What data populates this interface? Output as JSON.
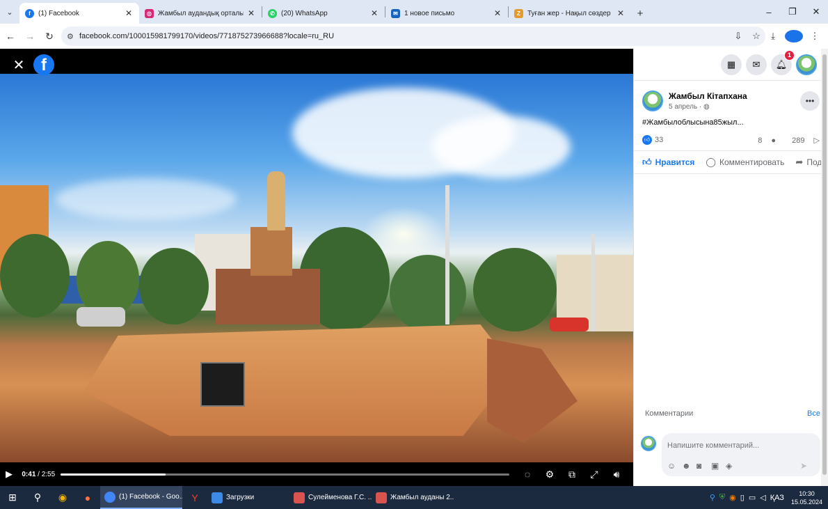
{
  "browser": {
    "tabs": [
      {
        "title": "(1) Facebook",
        "icon": "facebook-icon",
        "color": "#1877f2",
        "active": true
      },
      {
        "title": "Жамбыл аудандық орталық к",
        "icon": "instagram-icon",
        "color": "#d62976",
        "active": false
      },
      {
        "title": "(20) WhatsApp",
        "icon": "whatsapp-icon",
        "color": "#25d366",
        "active": false
      },
      {
        "title": "1 новое письмо",
        "icon": "mail-icon",
        "color": "#1565c0",
        "active": false
      },
      {
        "title": "Туған жер - Нақыл сөздер",
        "icon": "zq-icon",
        "color": "#e39b2b",
        "active": false
      }
    ],
    "url": "facebook.com/100015981799170/videos/771875273966688?locale=ru_RU"
  },
  "video": {
    "current_time": "0:41",
    "duration": "2:55",
    "progress": 0.234
  },
  "post": {
    "page_name": "Жамбыл Кітапхана",
    "date": "5 апрель ·",
    "text": "#Жамбылоблысына85жыл...",
    "likes": "33",
    "comments_count": "8",
    "views": "289",
    "actions": {
      "like": "Нравится",
      "comment": "Комментировать",
      "share": "Поделиться"
    }
  },
  "header": {
    "notifications_badge": "1"
  },
  "comments": {
    "title": "Комментарии",
    "all": "Все",
    "placeholder": "Напишите комментарий..."
  },
  "taskbar": {
    "apps": [
      {
        "label": "(1) Facebook - Goo...",
        "color": "#4285f4",
        "active": true
      },
      {
        "label": "Загрузки",
        "color": "#3c8ae6",
        "active": false
      },
      {
        "label": "Сулейменова Г.С. ...",
        "color": "#d9534f",
        "active": false
      },
      {
        "label": "Жамбыл ауданы 2...",
        "color": "#d9534f",
        "active": false
      }
    ],
    "lang": "ҚАЗ",
    "time": "10:30",
    "date": "15.05.2024"
  }
}
